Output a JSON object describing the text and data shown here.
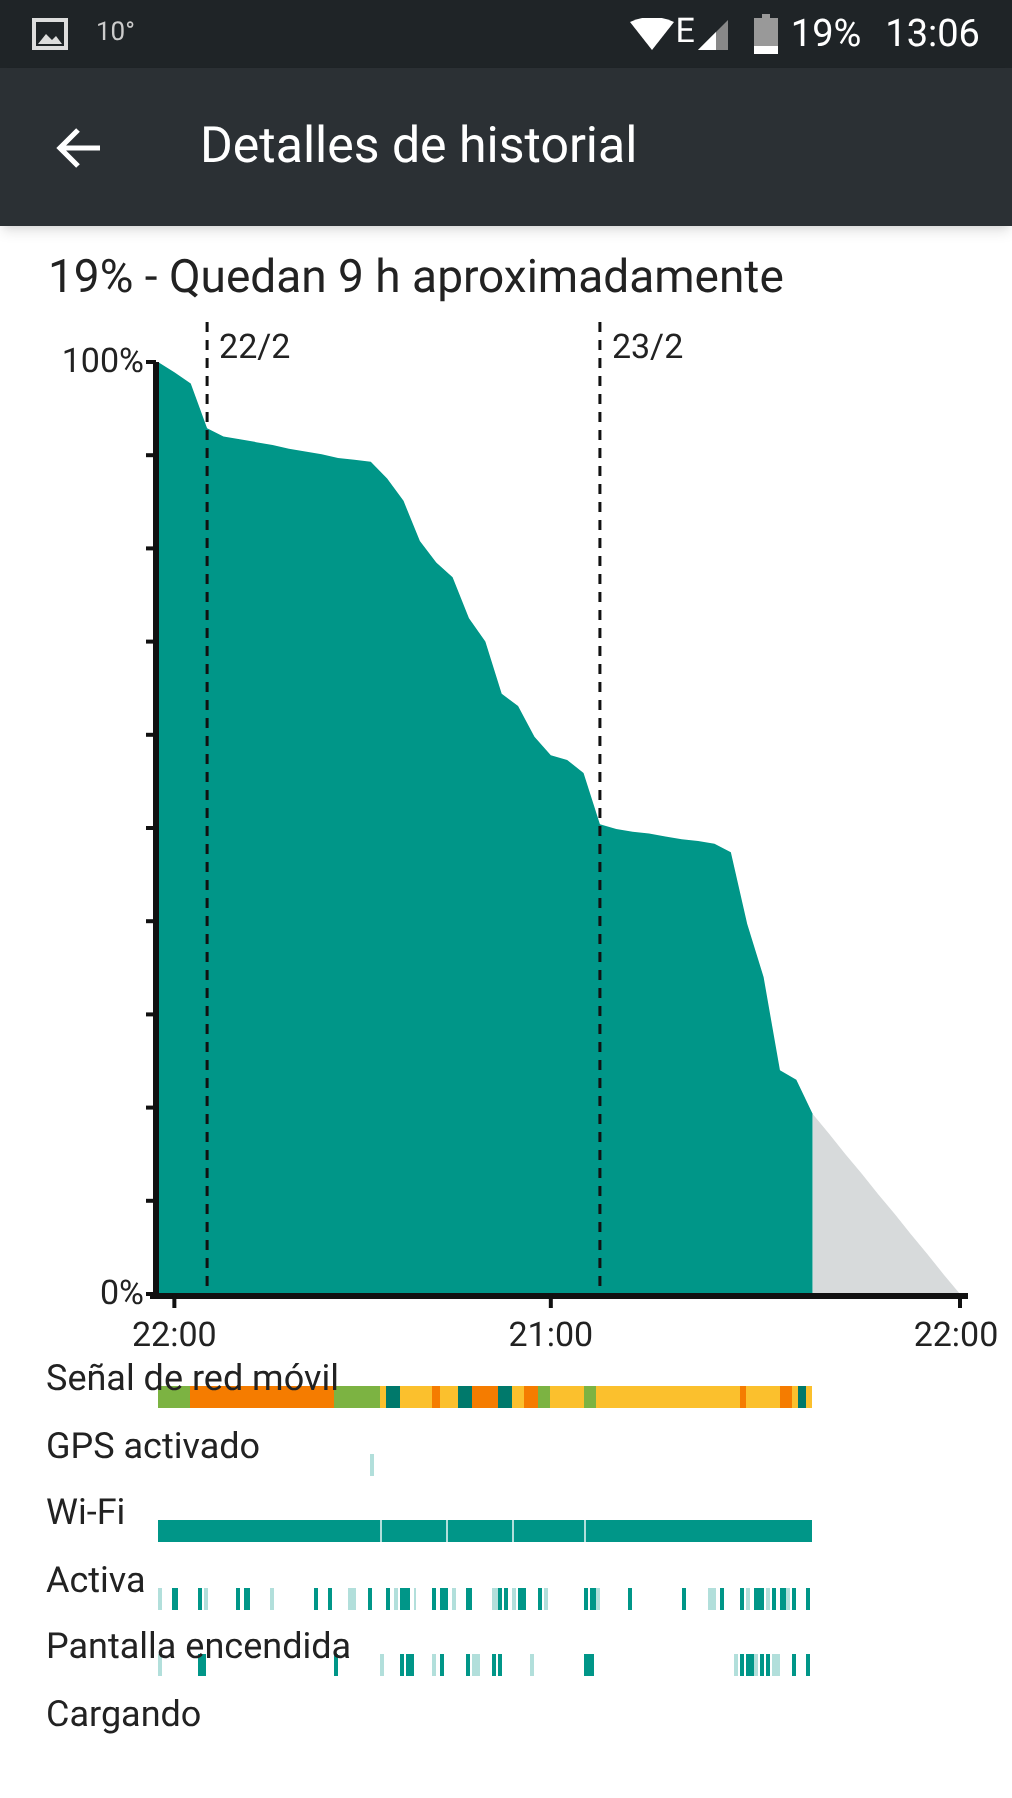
{
  "status_bar": {
    "temperature": "10°",
    "network": "E",
    "battery": "19%",
    "time": "13:06"
  },
  "toolbar": {
    "title": "Detalles de historial"
  },
  "summary": "19% - Quedan 9 h aproximadamente",
  "chart": {
    "chart_data": {
      "type": "area",
      "categories": [
        null,
        "22:00",
        null,
        null,
        null,
        null,
        null,
        null,
        null,
        null,
        null,
        null,
        null,
        null,
        null,
        null,
        null,
        null,
        null,
        null,
        null,
        null,
        null,
        null,
        "21:00",
        null,
        null,
        null,
        null,
        null,
        null,
        null,
        null,
        null,
        null,
        null,
        null,
        null,
        null,
        null,
        null,
        null,
        null,
        null,
        null,
        null,
        null,
        null,
        null,
        "22:00"
      ],
      "series": [
        {
          "color": "#009688",
          "values": [
            100,
            98.9,
            97.7,
            92.9,
            92,
            91.7,
            91.4,
            91.1,
            90.7,
            90.4,
            90.1,
            89.7,
            89.5,
            89.3,
            87.5,
            85.1,
            80.8,
            78.5,
            76.9,
            72.5,
            70,
            64.4,
            63.1,
            59.8,
            57.8,
            57.3,
            55.9,
            50.4,
            49.9,
            49.6,
            49.4,
            49.1,
            48.8,
            48.6,
            48.3,
            47.4,
            39.7,
            34,
            24,
            23,
            19.3,
            null,
            null,
            null,
            null,
            null,
            null,
            null,
            null,
            null
          ]
        },
        {
          "color": "#d7dadb",
          "values": [
            null,
            null,
            null,
            null,
            null,
            null,
            null,
            null,
            null,
            null,
            null,
            null,
            null,
            null,
            null,
            null,
            null,
            null,
            null,
            null,
            null,
            null,
            null,
            null,
            null,
            null,
            null,
            null,
            null,
            null,
            null,
            null,
            null,
            null,
            null,
            null,
            null,
            null,
            null,
            null,
            19.3,
            17.2,
            15,
            12.9,
            10.7,
            8.6,
            6.4,
            4.3,
            2.1,
            0
          ]
        }
      ],
      "ylim": [
        0,
        100
      ],
      "yticks": [
        {
          "value": 100,
          "label": "100%"
        },
        {
          "value": 0,
          "label": "0%"
        }
      ],
      "annotations": [
        "22/2",
        "23/2"
      ]
    }
  },
  "timelines": [
    {
      "label": "Señal de red móvil",
      "kind": "signal"
    },
    {
      "label": "GPS activado",
      "kind": "gps"
    },
    {
      "label": "Wi-Fi",
      "kind": "wifi"
    },
    {
      "label": "Activa",
      "kind": "awake"
    },
    {
      "label": "Pantalla encendida",
      "kind": "screen"
    },
    {
      "label": "Cargando",
      "kind": "charging"
    }
  ]
}
